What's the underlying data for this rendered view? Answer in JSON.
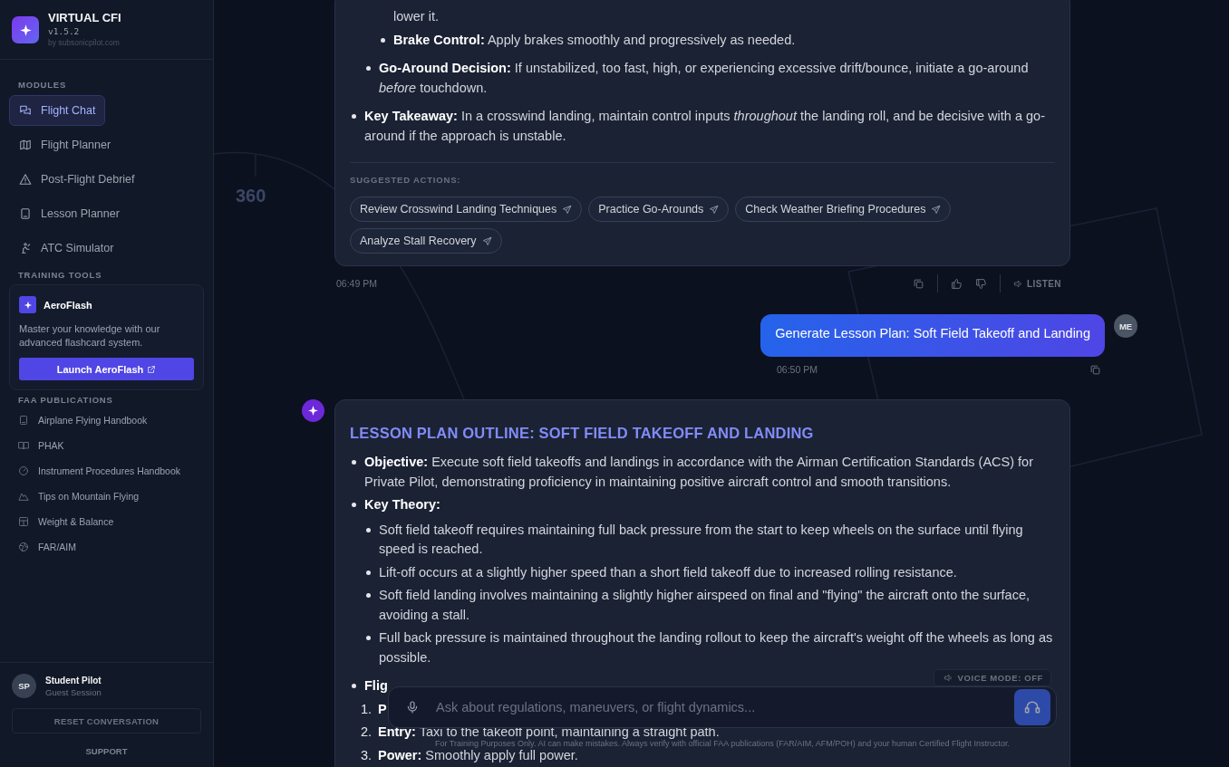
{
  "app": {
    "name": "VIRTUAL CFI",
    "version": "v1.5.2",
    "byline": "by subsonicpilot.com"
  },
  "sidebar": {
    "modules_heading": "MODULES",
    "modules": [
      {
        "label": "Flight Chat",
        "selected": true
      },
      {
        "label": "Flight Planner",
        "selected": false
      },
      {
        "label": "Post-Flight Debrief",
        "selected": false
      },
      {
        "label": "Lesson Planner",
        "selected": false
      },
      {
        "label": "ATC Simulator",
        "selected": false
      }
    ],
    "tools_heading": "TRAINING TOOLS",
    "aeroflash": {
      "title": "AeroFlash",
      "text": "Master your knowledge with our advanced flashcard system.",
      "button": "Launch AeroFlash"
    },
    "publications_heading": "FAA PUBLICATIONS",
    "publications": [
      "Airplane Flying Handbook",
      "PHAK",
      "Instrument Procedures Handbook",
      "Tips on Mountain Flying",
      "Weight & Balance",
      "FAR/AIM"
    ],
    "user": {
      "initials": "SP",
      "name": "Student Pilot",
      "session": "Guest Session"
    },
    "reset_button": "RESET CONVERSATION",
    "support_link": "SUPPORT"
  },
  "background": {
    "compass_label": "360"
  },
  "messages": [
    {
      "kind": "assistant",
      "items": [
        {
          "children": [
            {
              "children": [
                {
                  "text": "lower it.",
                  "kind": "continuation"
                },
                {
                  "text": "**Brake Control:** Apply brakes smoothly and progressively as needed."
                }
              ]
            },
            {
              "text": "**Go-Around Decision:** If unstabilized, too fast, high, or experiencing excessive drift/bounce, initiate a go-around *before* touchdown."
            }
          ]
        },
        {
          "text": "**Key Takeaway:** In a crosswind landing, maintain control inputs *throughout* the landing roll, and be decisive with a go-around if the approach is unstable."
        }
      ],
      "suggested_heading": "SUGGESTED ACTIONS:",
      "suggestions": [
        "Review Crosswind Landing Techniques",
        "Practice Go-Arounds",
        "Check Weather Briefing Procedures",
        "Analyze Stall Recovery"
      ],
      "time": "06:49 PM",
      "listen": "LISTEN"
    },
    {
      "kind": "user",
      "text": "Generate Lesson Plan: Soft Field Takeoff and Landing",
      "avatar": "ME",
      "time": "06:50 PM"
    },
    {
      "kind": "assistant",
      "title": "LESSON PLAN OUTLINE: SOFT FIELD TAKEOFF AND LANDING",
      "items": [
        {
          "text": "**Objective:** Execute soft field takeoffs and landings in accordance with the Airman Certification Standards (ACS) for Private Pilot, demonstrating proficiency in maintaining positive aircraft control and smooth transitions."
        },
        {
          "text": "**Key Theory:**",
          "children": [
            {
              "text": "Soft field takeoff requires maintaining full back pressure from the start to keep wheels on the surface until flying speed is reached."
            },
            {
              "text": "Lift-off occurs at a slightly higher speed than a short field takeoff due to increased rolling resistance."
            },
            {
              "text": "Soft field landing involves maintaining a slightly higher airspeed on final and \"flying\" the aircraft onto the surface, avoiding a stall."
            },
            {
              "text": "Full back pressure is maintained throughout the landing rollout to keep the aircraft's weight off the wheels as long as possible."
            }
          ]
        },
        {
          "text": "**Flig**"
        },
        {
          "marker": "1.",
          "text": "**P**"
        },
        {
          "marker": "2.",
          "text": "**Entry:** Taxi to the takeoff point, maintaining a straight path."
        },
        {
          "marker": "3.",
          "text": "**Power:** Smoothly apply full power."
        }
      ]
    }
  ],
  "composer": {
    "voice_mode": "VOICE MODE: OFF",
    "placeholder": "Ask about regulations, maneuvers, or flight dynamics...",
    "disclaimer": "For Training Purposes Only. AI can make mistakes. Always verify with official FAA publications (FAR/AIM, AFM/POH) and your human Certified Flight Instructor."
  }
}
